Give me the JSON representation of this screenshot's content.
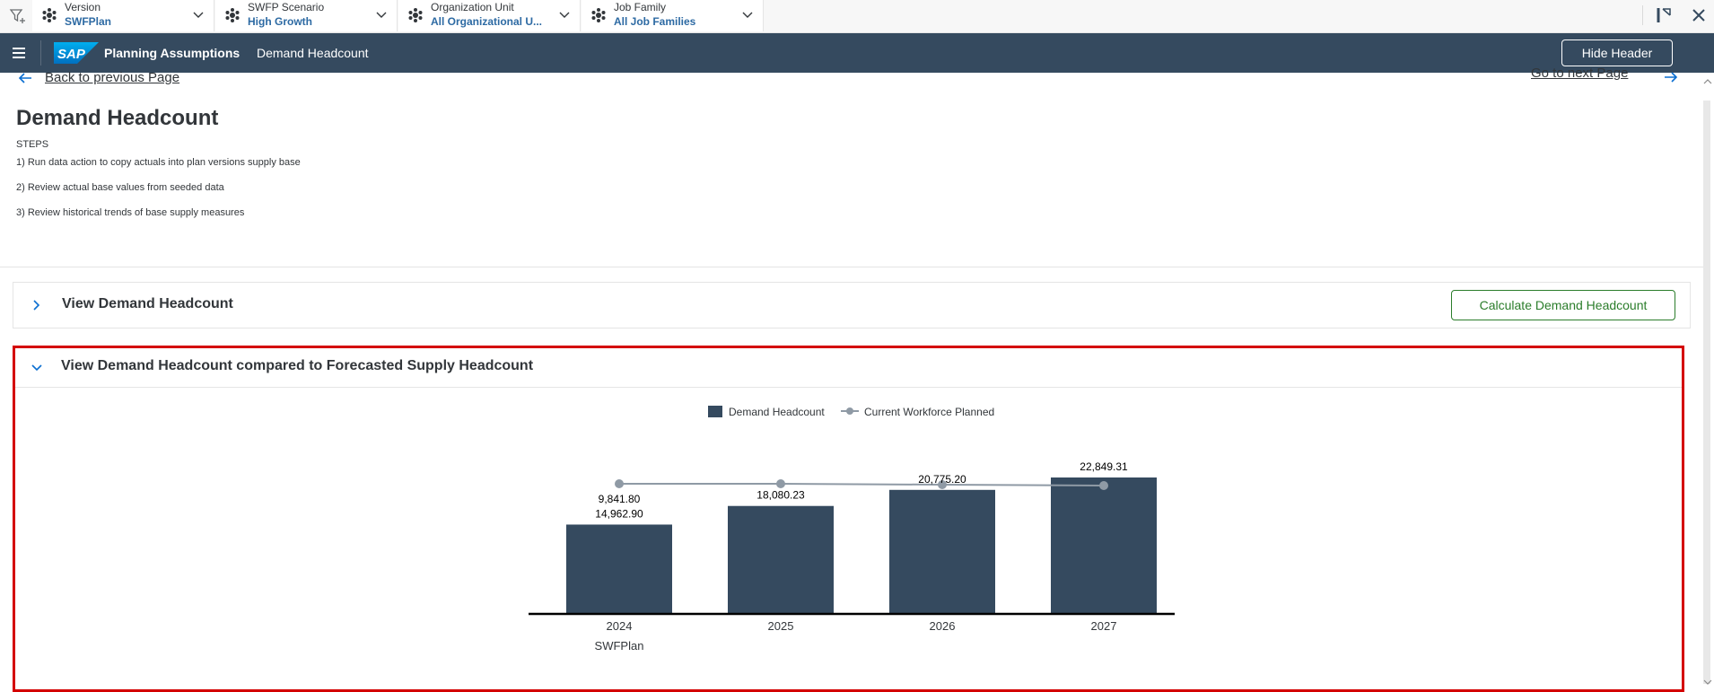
{
  "filters": [
    {
      "label": "Version",
      "value": "SWFPlan"
    },
    {
      "label": "SWFP Scenario",
      "value": "High Growth"
    },
    {
      "label": "Organization Unit",
      "value": "All Organizational U..."
    },
    {
      "label": "Job Family",
      "value": "All Job Families"
    }
  ],
  "shell": {
    "logo": "SAP",
    "app_title": "Planning Assumptions",
    "page_name": "Demand Headcount",
    "hide_header": "Hide Header"
  },
  "nav": {
    "back": "Back to previous Page",
    "next": "Go to next Page"
  },
  "page": {
    "title": "Demand Headcount",
    "steps_label": "STEPS",
    "steps": [
      "1) Run data action to copy actuals into plan versions supply base",
      "2) Review actual base values from seeded data",
      "3) Review historical trends of base supply measures"
    ]
  },
  "panels": {
    "view_demand": {
      "title": "View Demand Headcount",
      "button": "Calculate Demand Headcount"
    },
    "compare": {
      "title": "View Demand Headcount compared to Forecasted Supply Headcount"
    }
  },
  "colors": {
    "shell": "#354a5f",
    "bar": "#354a5f",
    "line": "#8f9aa5",
    "highlight_border": "#d40000",
    "button_green": "#2b7d2b"
  },
  "chart_data": {
    "type": "bar",
    "categories": [
      "2024",
      "2025",
      "2026",
      "2027"
    ],
    "group_label": "SWFPlan",
    "series": [
      {
        "name": "Demand Headcount",
        "type": "bar",
        "values": [
          14962.9,
          18080.23,
          20775.2,
          22849.31
        ],
        "labels": [
          "14,962.90",
          "18,080.23",
          "20,775.20",
          "22,849.31"
        ]
      },
      {
        "name": "Current Workforce Planned",
        "type": "line",
        "values": [
          9841.8,
          null,
          null,
          null
        ],
        "labels": [
          "9,841.80",
          "",
          "",
          ""
        ]
      }
    ],
    "legend": "top-center",
    "grid": false
  }
}
